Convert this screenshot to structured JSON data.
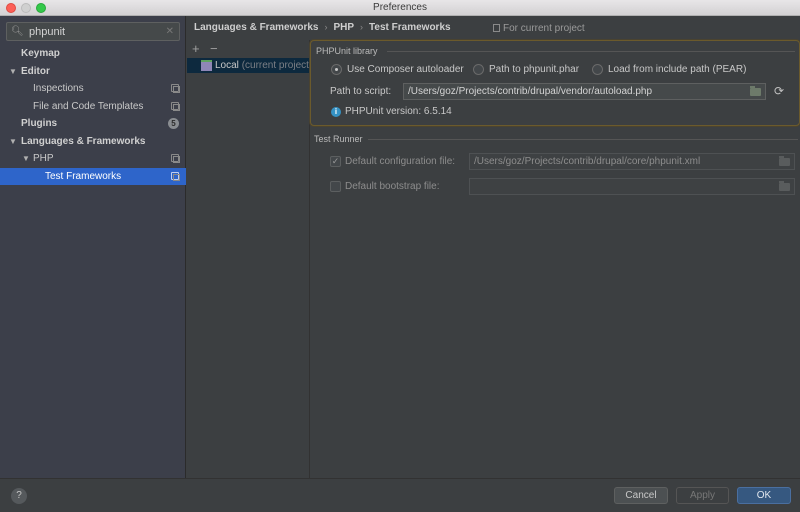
{
  "window": {
    "title": "Preferences"
  },
  "sidebar": {
    "search": {
      "value": "phpunit",
      "icon": "search-icon",
      "clear_icon": "clear-icon"
    },
    "items": [
      {
        "label": "Keymap",
        "level": 0,
        "bold": true,
        "expanded": null,
        "badge": null,
        "project_icon": false
      },
      {
        "label": "Editor",
        "level": 0,
        "bold": true,
        "expanded": true,
        "badge": null,
        "project_icon": false
      },
      {
        "label": "Inspections",
        "level": 1,
        "bold": false,
        "expanded": null,
        "badge": null,
        "project_icon": true
      },
      {
        "label": "File and Code Templates",
        "level": 1,
        "bold": false,
        "expanded": null,
        "badge": null,
        "project_icon": true
      },
      {
        "label": "Plugins",
        "level": 0,
        "bold": true,
        "expanded": null,
        "badge": "5",
        "project_icon": false
      },
      {
        "label": "Languages & Frameworks",
        "level": 0,
        "bold": true,
        "expanded": true,
        "badge": null,
        "project_icon": false
      },
      {
        "label": "PHP",
        "level": 1,
        "bold": false,
        "expanded": true,
        "badge": null,
        "project_icon": true
      },
      {
        "label": "Test Frameworks",
        "level": 2,
        "bold": false,
        "expanded": null,
        "badge": null,
        "project_icon": true,
        "selected": true
      }
    ]
  },
  "breadcrumb": {
    "items": [
      "Languages & Frameworks",
      "PHP",
      "Test Frameworks"
    ],
    "for_current_project": "For current project"
  },
  "config_list": {
    "add_label": "+",
    "remove_label": "−",
    "items": [
      {
        "name": "Local",
        "sub": "(current project)"
      }
    ]
  },
  "phpunit_library": {
    "title": "PHPUnit library",
    "options": [
      {
        "label": "Use Composer autoloader",
        "selected": true
      },
      {
        "label": "Path to phpunit.phar",
        "selected": false
      },
      {
        "label": "Load from include path (PEAR)",
        "selected": false
      }
    ],
    "path_label": "Path to script:",
    "path_value": "/Users/goz/Projects/contrib/drupal/vendor/autoload.php",
    "version_text": "PHPUnit version: 6.5.14"
  },
  "test_runner": {
    "title": "Test Runner",
    "default_config": {
      "label": "Default configuration file:",
      "checked": true,
      "value": "/Users/goz/Projects/contrib/drupal/core/phpunit.xml"
    },
    "default_bootstrap": {
      "label": "Default bootstrap file:",
      "checked": false,
      "value": ""
    }
  },
  "footer": {
    "help_label": "?",
    "cancel_label": "Cancel",
    "apply_label": "Apply",
    "ok_label": "OK"
  }
}
